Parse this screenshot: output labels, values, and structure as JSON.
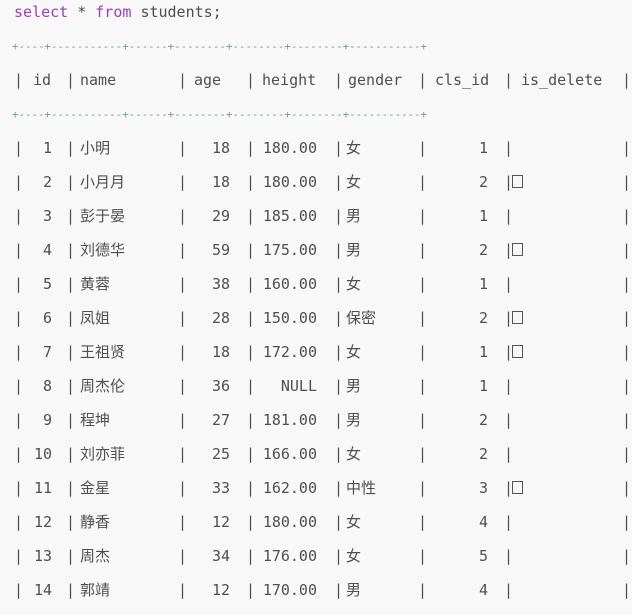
{
  "query": {
    "kw1": "select",
    "star": "*",
    "kw2": "from",
    "table": "students;"
  },
  "separator": "+----+-----------+------+--------+--------+--------+-----------+",
  "columns": [
    "id",
    "name",
    "age",
    "height",
    "gender",
    "cls_id",
    "is_delete"
  ],
  "rows": [
    {
      "id": "1",
      "name": "小明",
      "age": "18",
      "height": "180.00",
      "gender": "女",
      "cls_id": "1",
      "is_delete": ""
    },
    {
      "id": "2",
      "name": "小月月",
      "age": "18",
      "height": "180.00",
      "gender": "女",
      "cls_id": "2",
      "is_delete": "box"
    },
    {
      "id": "3",
      "name": "彭于晏",
      "age": "29",
      "height": "185.00",
      "gender": "男",
      "cls_id": "1",
      "is_delete": ""
    },
    {
      "id": "4",
      "name": "刘德华",
      "age": "59",
      "height": "175.00",
      "gender": "男",
      "cls_id": "2",
      "is_delete": "box"
    },
    {
      "id": "5",
      "name": "黄蓉",
      "age": "38",
      "height": "160.00",
      "gender": "女",
      "cls_id": "1",
      "is_delete": ""
    },
    {
      "id": "6",
      "name": "凤姐",
      "age": "28",
      "height": "150.00",
      "gender": "保密",
      "cls_id": "2",
      "is_delete": "box"
    },
    {
      "id": "7",
      "name": "王祖贤",
      "age": "18",
      "height": "172.00",
      "gender": "女",
      "cls_id": "1",
      "is_delete": "box"
    },
    {
      "id": "8",
      "name": "周杰伦",
      "age": "36",
      "height": "NULL",
      "gender": "男",
      "cls_id": "1",
      "is_delete": ""
    },
    {
      "id": "9",
      "name": "程坤",
      "age": "27",
      "height": "181.00",
      "gender": "男",
      "cls_id": "2",
      "is_delete": ""
    },
    {
      "id": "10",
      "name": "刘亦菲",
      "age": "25",
      "height": "166.00",
      "gender": "女",
      "cls_id": "2",
      "is_delete": ""
    },
    {
      "id": "11",
      "name": "金星",
      "age": "33",
      "height": "162.00",
      "gender": "中性",
      "cls_id": "3",
      "is_delete": "box"
    },
    {
      "id": "12",
      "name": "静香",
      "age": "12",
      "height": "180.00",
      "gender": "女",
      "cls_id": "4",
      "is_delete": ""
    },
    {
      "id": "13",
      "name": "周杰",
      "age": "34",
      "height": "176.00",
      "gender": "女",
      "cls_id": "5",
      "is_delete": ""
    },
    {
      "id": "14",
      "name": "郭靖",
      "age": "12",
      "height": "170.00",
      "gender": "男",
      "cls_id": "4",
      "is_delete": ""
    }
  ]
}
